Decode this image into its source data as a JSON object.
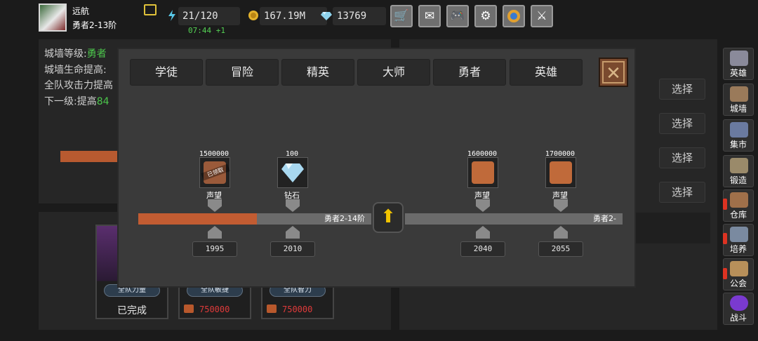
{
  "player": {
    "name": "远航",
    "rank": "勇者2-13阶"
  },
  "stats": {
    "energy": "21/120",
    "timer": "07:44 +1",
    "gold": "167.19M",
    "gems": "13769"
  },
  "toolbar_icons": [
    "cart-icon",
    "mail-icon",
    "gamepad-icon",
    "gear-icon",
    "aperture-icon",
    "sword-icon"
  ],
  "wall_info": {
    "level_label": "城墙等级:",
    "level_value": "勇者",
    "hp_label": "城墙生命提高:",
    "atk_label": "全队攻击力提高",
    "next_label": "下一级:提高",
    "next_value": "84"
  },
  "select_label": "选择",
  "cards": [
    {
      "tag": "全队力量",
      "status": "已完成"
    },
    {
      "tag": "全队敏捷",
      "cost": "750000"
    },
    {
      "tag": "全队智力",
      "cost": "750000"
    }
  ],
  "sidebar": [
    {
      "label": "英雄",
      "icon": "helmet-icon"
    },
    {
      "label": "城墙",
      "icon": "wall-icon"
    },
    {
      "label": "集市",
      "icon": "market-icon"
    },
    {
      "label": "锻造",
      "icon": "anvil-icon"
    },
    {
      "label": "仓库",
      "icon": "warehouse-icon"
    },
    {
      "label": "培养",
      "icon": "cultivate-icon"
    },
    {
      "label": "公会",
      "icon": "guild-icon"
    },
    {
      "label": "战斗",
      "icon": "portal-icon"
    }
  ],
  "modal": {
    "tabs": [
      "学徒",
      "冒险",
      "精英",
      "大师",
      "勇者",
      "英雄"
    ],
    "progress_fraction": 0.51,
    "track_left_label": "勇者2-14阶",
    "track_right_label": "勇者2-",
    "claimed_stamp": "已领取",
    "rewards": [
      {
        "amount": "1500000",
        "name": "声望",
        "level": "1995",
        "claimed": true
      },
      {
        "amount": "100",
        "name": "钻石",
        "level": "2010",
        "claimed": false
      },
      {
        "amount": "1600000",
        "name": "声望",
        "level": "2040",
        "claimed": false
      },
      {
        "amount": "1700000",
        "name": "声望",
        "level": "2055",
        "claimed": false
      }
    ]
  },
  "colors": {
    "accent_orange": "#c25c32",
    "arrow_yellow": "#f2c400",
    "green": "#4cc64c",
    "cost_red": "#e03a3a"
  }
}
